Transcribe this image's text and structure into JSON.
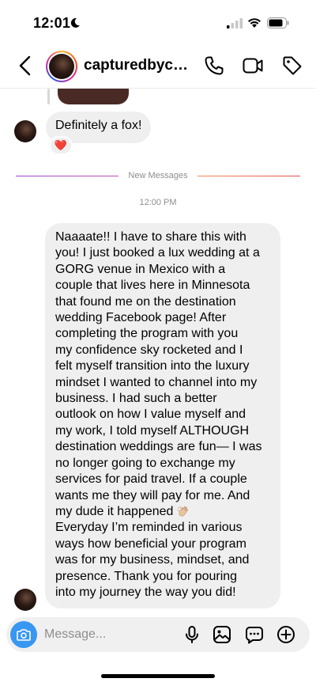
{
  "status_bar": {
    "time": "12:01"
  },
  "header": {
    "username": "capturedbycas..."
  },
  "thread": {
    "prev_message": {
      "text": "Definitely a fox!",
      "reaction": "❤️"
    },
    "divider_label": "New Messages",
    "timestamp": "12:00 PM",
    "long_message": {
      "lines": [
        "Naaaate!! I have to share this with",
        "you! I just booked a lux wedding at a",
        "GORG venue in Mexico with a",
        "couple that lives here in Minnesota",
        "that found me on the destination",
        "wedding Facebook page! After",
        "completing the program with you",
        "my confidence sky rocketed and I",
        "felt myself transition into the luxury",
        "mindset I wanted to channel into my",
        "business. I had such a better",
        "outlook on how I value myself and",
        "my work, I told myself ALTHOUGH",
        "destination weddings are fun— I was",
        "no longer going to exchange my",
        "services for paid travel. If a couple",
        "wants me they will pay for me. And",
        "my dude it happened",
        "Everyday I’m reminded in various",
        "ways how beneficial your program",
        "was for my business, mindset, and",
        "presence. Thank you for pouring",
        "into my journey the way you did!"
      ],
      "emoji": "clapping-hands"
    }
  },
  "composer": {
    "placeholder": "Message..."
  },
  "colors": {
    "accent": "#3897f0",
    "bubble": "#efefef",
    "muted_text": "#8e8e8e"
  }
}
